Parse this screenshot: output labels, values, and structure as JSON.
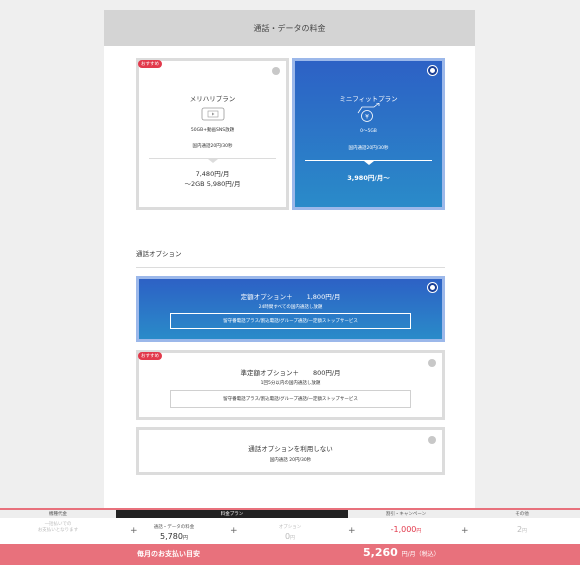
{
  "header": {
    "title": "通話・データの料金"
  },
  "plans": [
    {
      "badge": "おすすめ",
      "name": "メリハリプラン",
      "data_line": "50GB+動画SNS放題",
      "call_line": "国内通話20円/30秒",
      "price1": "7,480円/月",
      "price2": "～2GB 5,980円/月",
      "selected": false
    },
    {
      "name": "ミニフィットプラン",
      "data_line": "0～5GB",
      "call_line": "国内通話20円/30秒",
      "price1": "3,980円/月～",
      "selected": true
    }
  ],
  "call_options": {
    "title": "通話オプション",
    "items": [
      {
        "name": "定額オプション＋",
        "amount": "1,800円/月",
        "sub": "24時間すべての国内通話し放題",
        "box": "留守番電話プラス/割込電話/グループ通話/一定額ストップサービス",
        "selected": true
      },
      {
        "badge": "おすすめ",
        "name": "準定額オプション＋",
        "amount": "800円/月",
        "sub": "1回5分以内の国内通話し放題",
        "box": "留守番電話プラス/割込電話/グループ通話/一定額ストップサービス",
        "selected": false
      },
      {
        "name": "通話オプションを利用しない",
        "sub": "国内通話 20円/30秒",
        "selected": false
      }
    ]
  },
  "bottom": {
    "device_head": "機種代金",
    "device_val1": "一括払いでの",
    "device_val2": "お支払いとなります",
    "plan_head": "料金プラン",
    "plan_label": "通話・データの料金",
    "plan_value": "5,780",
    "plan_unit": "円",
    "option_label": "オプション",
    "option_value": "0",
    "option_unit": "円",
    "discount_head": "割引・キャンペーン",
    "discount_value": "-1,000",
    "discount_unit": "円",
    "other_head": "その他",
    "other_value": "2",
    "other_unit": "円",
    "plus": "+",
    "total_label": "毎月のお支払い目安",
    "total_value": "5,260",
    "total_unit": "円/月（税込）"
  },
  "colors": {
    "accent": "#2d61c5",
    "brand_red": "#e23a4c",
    "total_bar": "#e8717c"
  }
}
